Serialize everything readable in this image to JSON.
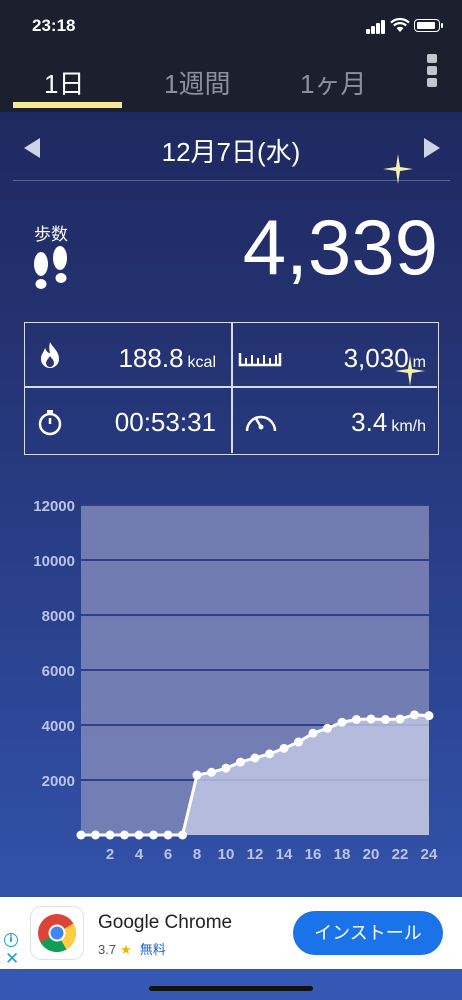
{
  "status_bar": {
    "time": "23:18"
  },
  "tabs": [
    {
      "label": "1日",
      "active": true
    },
    {
      "label": "1週間",
      "active": false
    },
    {
      "label": "1ヶ月",
      "active": false
    }
  ],
  "date": {
    "label": "12月7日(水)"
  },
  "steps": {
    "label": "歩数",
    "value": "4,339"
  },
  "stats": {
    "calories": {
      "value": "188.8",
      "unit": "kcal",
      "icon": "flame-icon"
    },
    "distance": {
      "value": "3,030",
      "unit": "m",
      "icon": "ruler-icon"
    },
    "duration": {
      "value": "00:53:31",
      "icon": "stopwatch-icon"
    },
    "speed": {
      "value": "3.4",
      "unit": "km/h",
      "icon": "speedometer-icon"
    }
  },
  "chart_data": {
    "type": "line",
    "title": "",
    "xlabel": "",
    "ylabel": "",
    "x": [
      0,
      1,
      2,
      3,
      4,
      5,
      6,
      7,
      8,
      9,
      10,
      11,
      12,
      13,
      14,
      15,
      16,
      17,
      18,
      19,
      20,
      21,
      22,
      23,
      24
    ],
    "values": [
      0,
      0,
      0,
      0,
      0,
      0,
      0,
      0,
      2180,
      2280,
      2430,
      2650,
      2800,
      2950,
      3150,
      3380,
      3700,
      3880,
      4100,
      4200,
      4220,
      4200,
      4220,
      4370,
      4339
    ],
    "x_tick_labels": [
      "2",
      "4",
      "6",
      "8",
      "10",
      "12",
      "14",
      "16",
      "18",
      "20",
      "22",
      "24"
    ],
    "y_tick_labels": [
      "2000",
      "4000",
      "6000",
      "8000",
      "10000",
      "12000"
    ],
    "ylim": [
      0,
      12000
    ],
    "xlim": [
      0,
      24
    ],
    "grid": true,
    "colors": {
      "line": "#ffffff",
      "fill": "#c5cae6",
      "plot_bg": "#7f87b8",
      "grid": "#2c3f8c"
    }
  },
  "ad": {
    "title": "Google Chrome",
    "rating": "3.7",
    "price": "無料",
    "button": "インストール",
    "icon": "chrome-logo-icon"
  },
  "colors": {
    "tab_underline": "#f3ea93",
    "ad_button": "#1a73e8"
  }
}
